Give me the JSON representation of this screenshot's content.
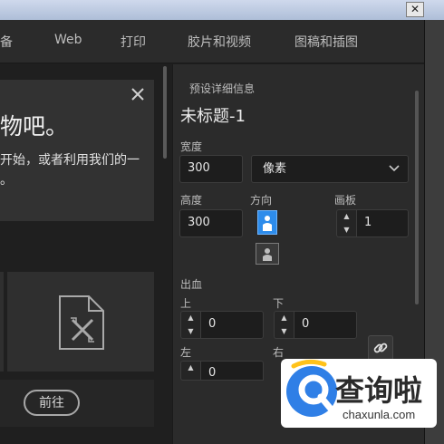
{
  "window": {
    "close_glyph": "✕"
  },
  "tabs": [
    {
      "label": "备"
    },
    {
      "label": "Web"
    },
    {
      "label": "打印"
    },
    {
      "label": "胶片和视频"
    },
    {
      "label": "图稿和插图"
    }
  ],
  "welcome": {
    "title": "物吧。",
    "text_line1": "开始，或者利用我们的一",
    "text_line2": "。",
    "close_icon": "close-icon"
  },
  "template_thumb": {
    "icon": "document-pencil-icon"
  },
  "go_button": {
    "label": "前往"
  },
  "preset": {
    "section_label": "预设详细信息",
    "title": "未标题-1",
    "width": {
      "label": "宽度",
      "value": "300"
    },
    "unit": {
      "selected": "像素"
    },
    "height": {
      "label": "高度",
      "value": "300"
    },
    "orientation": {
      "label": "方向",
      "selected": "portrait"
    },
    "artboard": {
      "label": "画板",
      "value": "1"
    },
    "bleed": {
      "label": "出血",
      "top": {
        "label": "上",
        "value": "0"
      },
      "bottom": {
        "label": "下",
        "value": "0"
      },
      "left": {
        "label": "左",
        "value": "0"
      },
      "right": {
        "label": "右"
      }
    }
  },
  "watermark": {
    "text_cn": "查询啦",
    "url": "chaxunla.com"
  },
  "colors": {
    "accent": "#2d8ceb",
    "panel": "#2b2b2b",
    "card": "#323232"
  }
}
